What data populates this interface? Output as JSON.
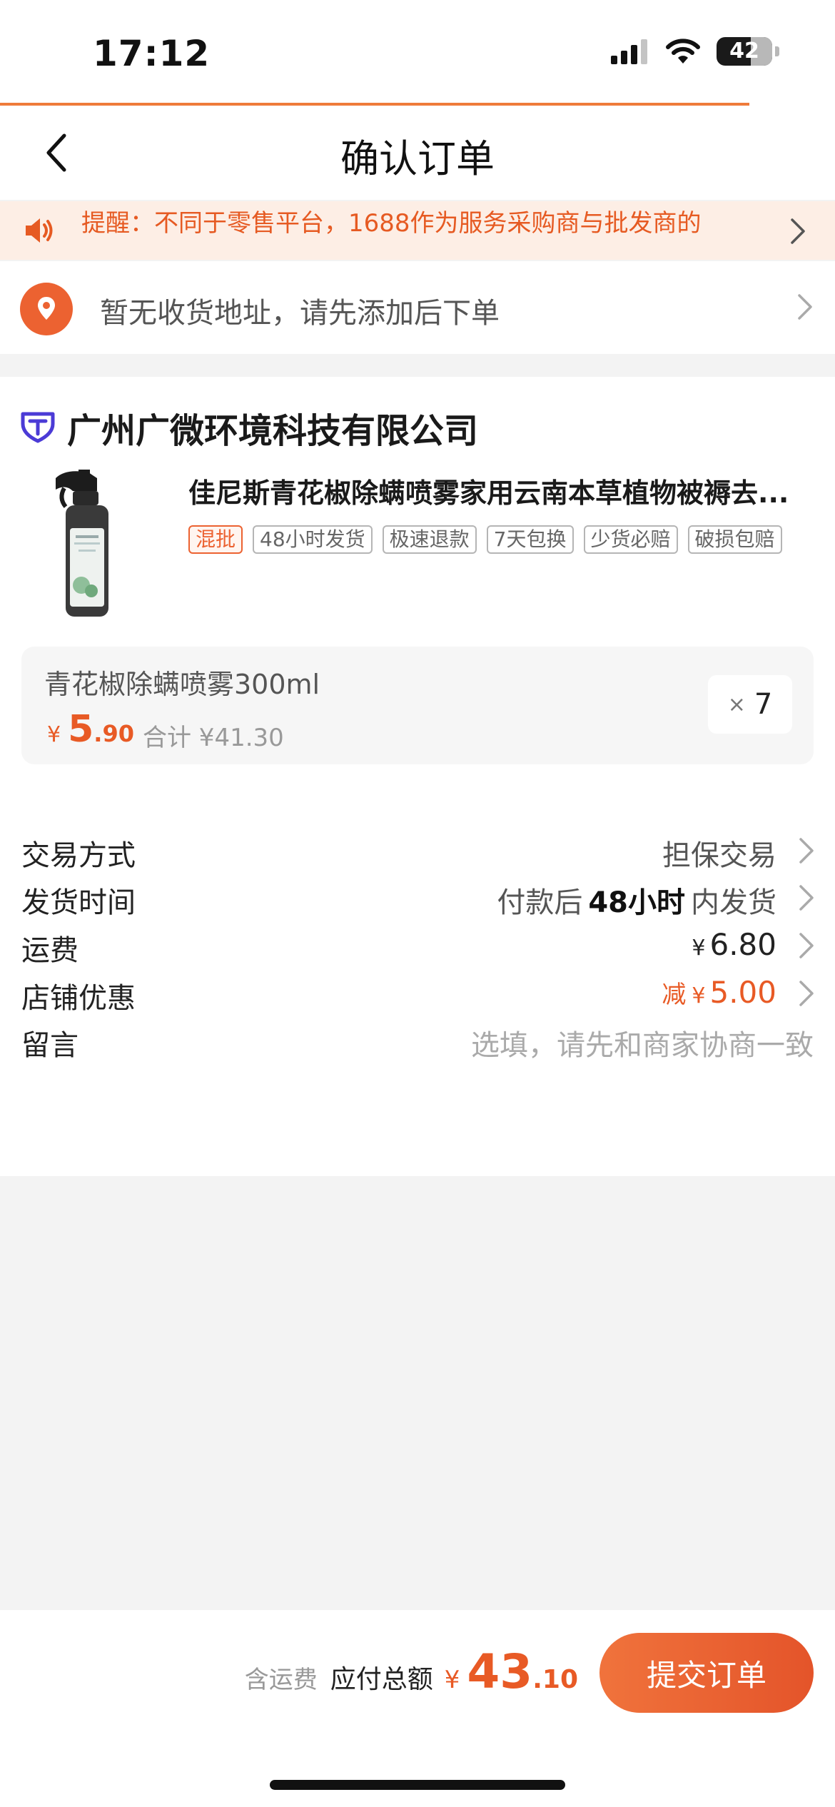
{
  "status_bar": {
    "time": "17:12",
    "battery": "42"
  },
  "header": {
    "title": "确认订单"
  },
  "notice": {
    "text": "提醒：不同于零售平台，1688作为服务采购商与批发商的"
  },
  "address": {
    "placeholder": "暂无收货地址，请先添加后下单"
  },
  "shop": {
    "name": "广州广微环境科技有限公司"
  },
  "product": {
    "title": "佳尼斯青花椒除螨喷雾家用云南本草植物被褥去...",
    "tags": [
      "混批",
      "48小时发货",
      "极速退款",
      "7天包换",
      "少货必赔",
      "破损包赔"
    ]
  },
  "sku": {
    "name": "青花椒除螨喷雾300ml",
    "price_symbol": "¥",
    "price_int": "5",
    "price_dec": ".90",
    "subtotal": "合计 ¥41.30",
    "qty_x": "×",
    "quantity": "7"
  },
  "rows": {
    "trade": {
      "label": "交易方式",
      "value": "担保交易"
    },
    "delivery": {
      "label": "发货时间",
      "prefix": "付款后",
      "strong": "48小时",
      "suffix": "内发货"
    },
    "shipping": {
      "label": "运费",
      "symbol": "¥",
      "amount": "6.80"
    },
    "discount": {
      "label": "店铺优惠",
      "prefix": "减",
      "symbol": "¥",
      "amount": "5.00"
    },
    "message": {
      "label": "留言",
      "placeholder": "选填，请先和商家协商一致"
    }
  },
  "footer": {
    "incl_shipping": "含运费",
    "total_label": "应付总额",
    "symbol": "¥",
    "total_int": "43",
    "total_dec": ".10",
    "submit_label": "提交订单"
  },
  "colors": {
    "accent": "#ec6231",
    "price": "#e85a25",
    "notice_bg": "#fdeee5",
    "shop_badge": "#4b3bd6"
  }
}
